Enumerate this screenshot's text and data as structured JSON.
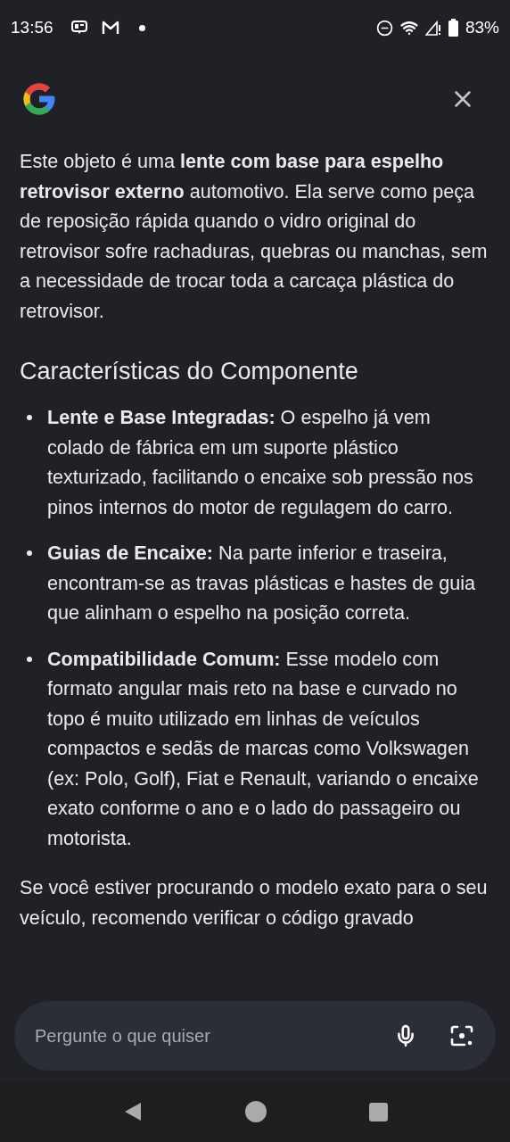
{
  "status_bar": {
    "time": "13:56",
    "battery": "83%"
  },
  "answer": {
    "intro": "Este objeto é uma **lente com base para espelho retrovisor externo** automotivo. Ela serve como peça de reposição rápida quando o vidro original do retrovisor sofre rachaduras, quebras ou manchas, sem a necessidade de trocar toda a carcaça plástica do retrovisor.",
    "heading": "Características do Componente",
    "bullets": [
      {
        "text": "**Lente e Base Integradas:** O espelho já vem colado de fábrica em um suporte plástico texturizado, facilitando o encaixe sob pressão nos pinos internos do motor de regulagem do carro."
      },
      {
        "text": "**Guias de Encaixe:** Na parte inferior e traseira, encontram-se as travas plásticas e hastes de guia que alinham o espelho na posição correta."
      },
      {
        "text": "**Compatibilidade Comum:** Esse modelo com formato angular mais reto na base e curvado no topo é muito utilizado em linhas de veículos compactos e sedãs de marcas como Volkswagen (ex: Polo, Golf), Fiat e Renault, variando o encaixe exato conforme o ano e o lado do passageiro ou motorista."
      }
    ],
    "closing": "Se você estiver procurando o modelo exato para o seu veículo, recomendo verificar o código gravado"
  },
  "prompt": {
    "placeholder": "Pergunte o que quiser"
  }
}
